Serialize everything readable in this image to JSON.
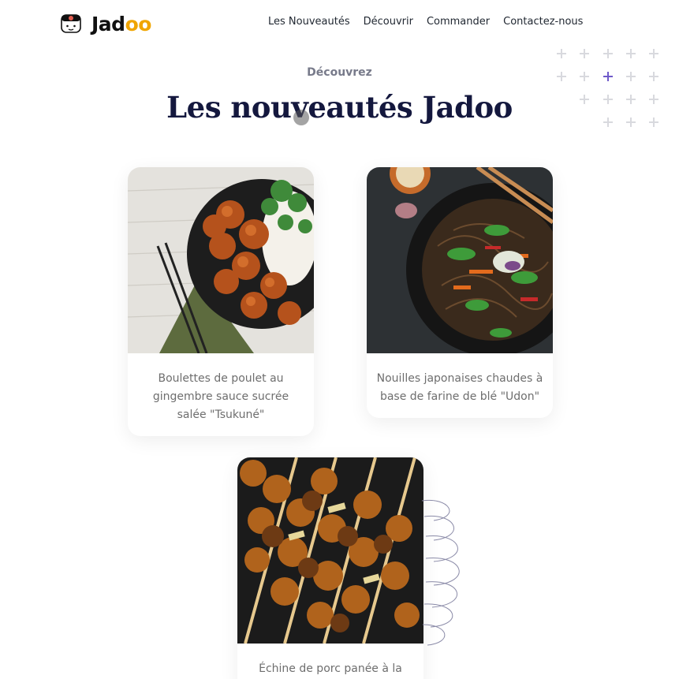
{
  "brand": {
    "name_part1": "Jad",
    "name_part2": "oo"
  },
  "nav": {
    "items": [
      {
        "label": "Les Nouveautés"
      },
      {
        "label": "Découvrir"
      },
      {
        "label": "Commander"
      },
      {
        "label": "Contactez-nous"
      }
    ]
  },
  "section": {
    "kicker": "Découvrez",
    "title": "Les nouveautés Jadoo"
  },
  "cards": [
    {
      "caption": "Boulettes de poulet au gingembre sauce sucrée salée \"Tsukuné\"",
      "image": "chicken-meatballs-rice-broccoli-photo"
    },
    {
      "caption": "Nouilles japonaises chaudes à base de farine de blé \"Udon\"",
      "image": "udon-noodles-wok-photo"
    },
    {
      "caption": "Échine de porc panée à la",
      "image": "yakitori-skewers-photo"
    }
  ],
  "colors": {
    "accent": "#f0a500",
    "heading": "#14183e",
    "plus_accent": "#6f5ac9"
  }
}
